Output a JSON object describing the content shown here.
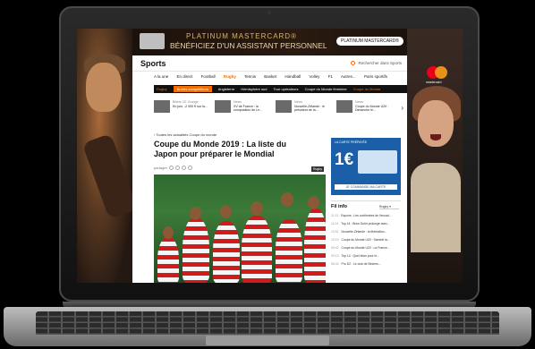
{
  "banner": {
    "line1": "PLATINUM MASTERCARD®",
    "line2": "BÉNÉFICIEZ D'UN ASSISTANT PERSONNEL",
    "cta": "PLATINUM MASTERCARD®",
    "mc_label": "mastercard"
  },
  "site": {
    "logo": "Sports",
    "search_placeholder": "Rechercher dans Sports",
    "nav": [
      "A la une",
      "En direct",
      "Football",
      "Rugby",
      "Tennis",
      "Basket",
      "Handball",
      "Volley",
      "F1",
      "Autres...",
      "Paris sportifs"
    ],
    "nav_active": "Rugby",
    "subnav": [
      "Rugby",
      "Autres compétitions",
      "Angleterre",
      "Hémisphère sud",
      "Tour opérateurs",
      "Coupe du Monde féminine",
      "Coupe du Monde"
    ]
  },
  "ticker": [
    {
      "src": "Billets CE Orange",
      "text": "En juin, -2 000 € sur la..."
    },
    {
      "src": "News",
      "text": "XV de France : la composition de Le..."
    },
    {
      "src": "News",
      "text": "Nouvelle-Zélande : le président de la..."
    },
    {
      "src": "News",
      "text": "Coupe du Monde U20 : Dimanche le..."
    }
  ],
  "article": {
    "breadcrumb": "Toutes les actualités Coupe du monde",
    "title": "Coupe du Monde 2019 : La liste du Japon pour préparer le Mondial",
    "share_label": "partager",
    "tag": "Rugby"
  },
  "side_ad": {
    "caption": "LA CARTE PRÉPAYÉE",
    "amount": "1€",
    "cta": "JE COMMANDE MA CARTE"
  },
  "fil_info": {
    "title": "Fil info",
    "filter": "Rugby",
    "items": [
      {
        "time": "11:13",
        "text": "Espoirs : Les confirmées de l'encad..."
      },
      {
        "time": "11:04",
        "text": "Top 14 : Brice Dulin prolonge avec..."
      },
      {
        "time": "10:51",
        "text": "Nouvelle-Zélande : la fédération..."
      },
      {
        "time": "10:15",
        "text": "Coupe du Monde U20 : Samedi la..."
      },
      {
        "time": "09:42",
        "text": "Coupe du Monde U20 : La France..."
      },
      {
        "time": "09:10",
        "text": "Top 14 : Quel bilan pour le..."
      },
      {
        "time": "08:43",
        "text": "Pro D2 : Le club de Béziers..."
      }
    ]
  }
}
